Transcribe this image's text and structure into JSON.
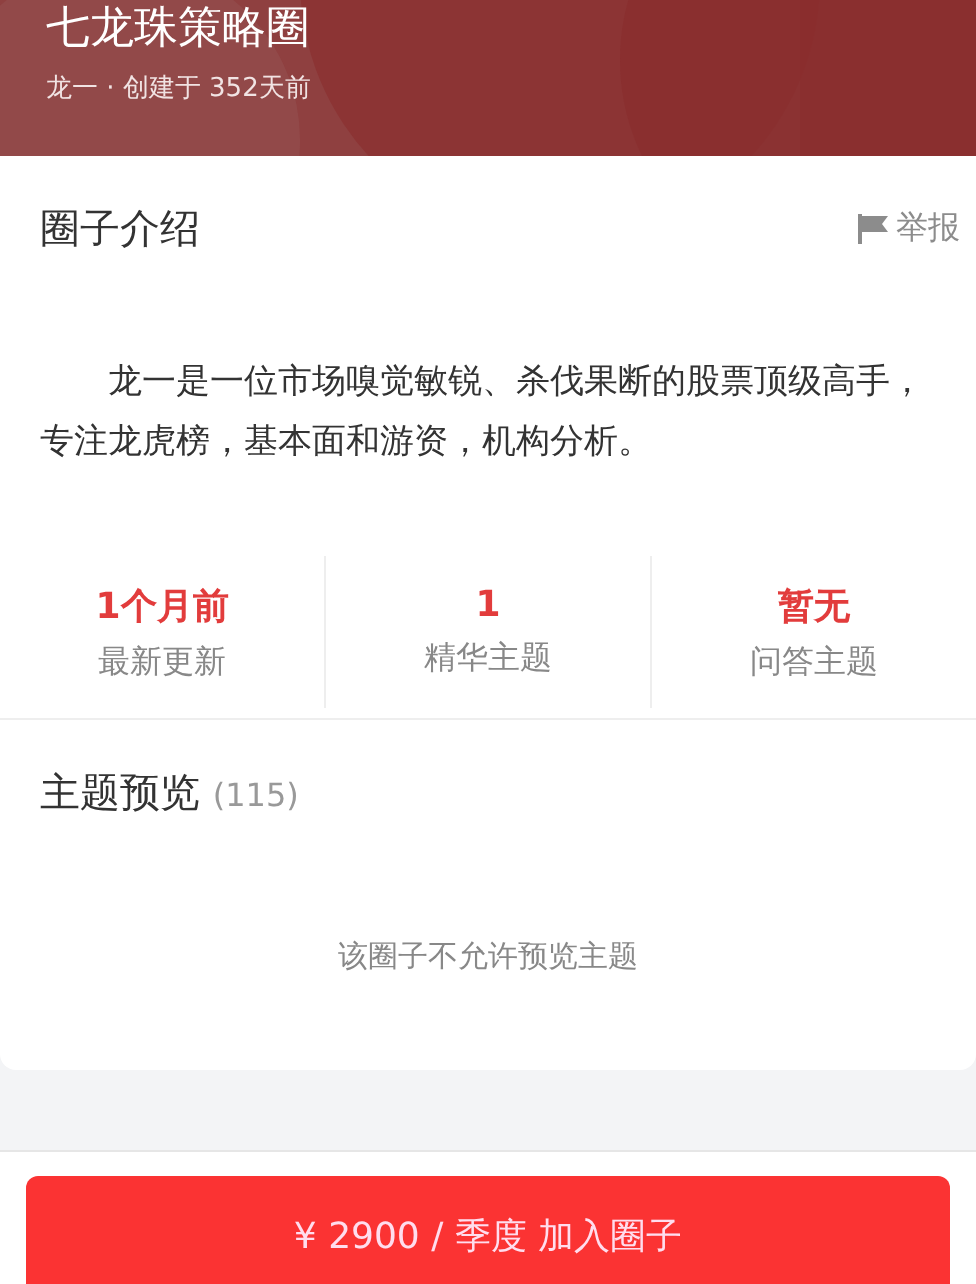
{
  "header": {
    "title": "七龙珠策略圈",
    "subtitle": "龙一 · 创建于 352天前"
  },
  "intro": {
    "title": "圈子介绍",
    "report": "举报",
    "text": "龙一是一位市场嗅觉敏锐、杀伐果断的股票顶级高手，专注龙虎榜，基本面和游资，机构分析。"
  },
  "stats": [
    {
      "value": "1个月前",
      "label": "最新更新"
    },
    {
      "value": "1",
      "label": "精华主题"
    },
    {
      "value": "暂无",
      "label": "问答主题"
    }
  ],
  "preview": {
    "title": "主题预览",
    "count": "(115)",
    "empty": "该圈子不允许预览主题"
  },
  "join_button": "¥ 2900 / 季度 加入圈子"
}
